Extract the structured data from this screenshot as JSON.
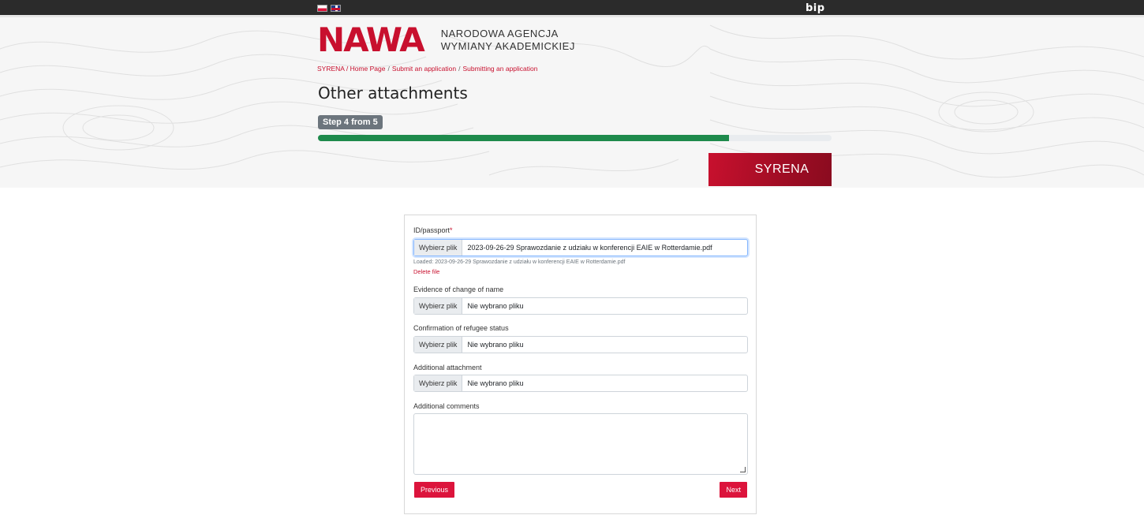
{
  "topbar": {
    "languages": [
      "pl-flag",
      "uk-flag"
    ],
    "bip_label": "bip"
  },
  "logo": {
    "mark": "NAWA",
    "line1": "NARODOWA AGENCJA",
    "line2": "WYMIANY AKADEMICKIEJ"
  },
  "breadcrumb": [
    "SYRENA / Home Page",
    "Submit an application",
    "Submitting an application"
  ],
  "page": {
    "title": "Other attachments",
    "step_label": "Step 4 from 5",
    "progress_fraction": 0.8,
    "banner_label": "SYRENA"
  },
  "form": {
    "id_passport": {
      "label": "ID/passport",
      "required_mark": "*",
      "button": "Wybierz plik",
      "value": "2023-09-26-29 Sprawozdanie z udziału w konferencji EAIE w Rotterdamie.pdf",
      "loaded_text": "Loaded: 2023-09-26-29 Sprawozdanie z udziału w konferencji EAIE w Rotterdamie.pdf",
      "delete_label": "Delete file"
    },
    "name_change": {
      "label": "Evidence of change of name",
      "button": "Wybierz plik",
      "value": "Nie wybrano pliku"
    },
    "refugee": {
      "label": "Confirmation of refugee status",
      "button": "Wybierz plik",
      "value": "Nie wybrano pliku"
    },
    "additional": {
      "label": "Additional attachment",
      "button": "Wybierz plik",
      "value": "Nie wybrano pliku"
    },
    "comments": {
      "label": "Additional comments",
      "value": ""
    },
    "previous_label": "Previous",
    "next_label": "Next"
  },
  "colors": {
    "brand_red": "#c8102e",
    "progress_green": "#1e8a4c",
    "badge_gray": "#6c757d"
  }
}
